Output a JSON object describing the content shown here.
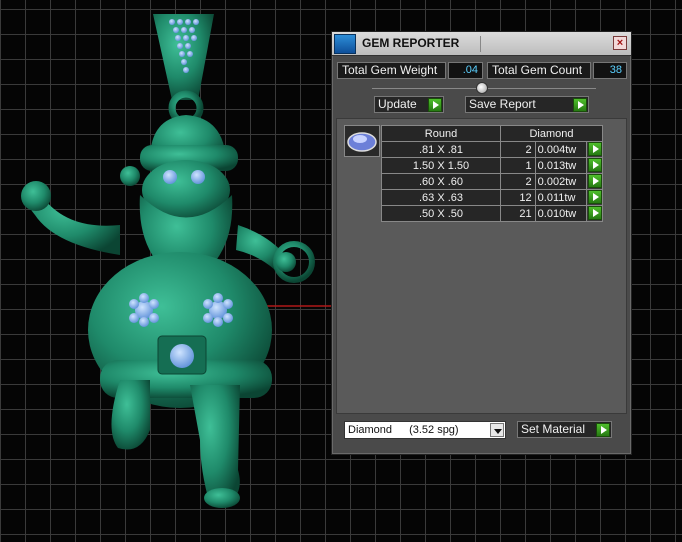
{
  "window": {
    "title": "GEM REPORTER",
    "close_glyph": "×"
  },
  "totals": {
    "weight_label": "Total Gem Weight",
    "weight_value": ".04",
    "count_label": "Total Gem Count",
    "count_value": "38"
  },
  "actions": {
    "update_label": "Update",
    "save_report_label": "Save Report"
  },
  "gem_table": {
    "shape_header": "Round",
    "material_header": "Diamond",
    "rows": [
      {
        "size": ".81 X .81",
        "count": "2",
        "weight": "0.004tw"
      },
      {
        "size": "1.50 X 1.50",
        "count": "1",
        "weight": "0.013tw"
      },
      {
        "size": ".60 X .60",
        "count": "2",
        "weight": "0.002tw"
      },
      {
        "size": ".63 X .63",
        "count": "12",
        "weight": "0.011tw"
      },
      {
        "size": ".50 X .50",
        "count": "21",
        "weight": "0.010tw"
      }
    ]
  },
  "material": {
    "selected": "Diamond",
    "density": "(3.52 spg)",
    "set_label": "Set Material"
  },
  "colors": {
    "model_green": "#1f8a6a",
    "gem_blue": "#7fb2f0",
    "value_cyan": "#5ad0ff",
    "go_green": "#3fa020"
  }
}
